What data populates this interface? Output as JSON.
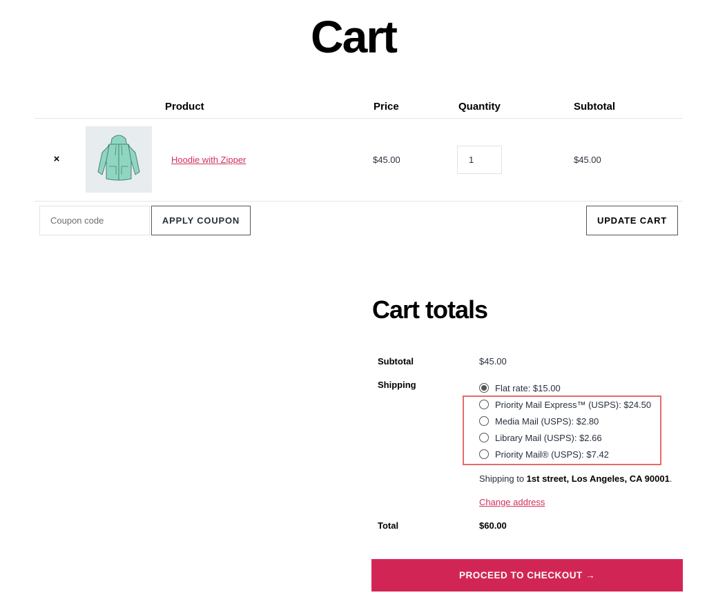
{
  "page": {
    "title": "Cart"
  },
  "table": {
    "headers": {
      "product": "Product",
      "price": "Price",
      "quantity": "Quantity",
      "subtotal": "Subtotal"
    },
    "rows": [
      {
        "remove_label": "×",
        "product_name": "Hoodie with Zipper",
        "thumbnail_icon": "hoodie-icon",
        "price": "$45.00",
        "quantity": "1",
        "subtotal": "$45.00"
      }
    ]
  },
  "coupon": {
    "placeholder": "Coupon code",
    "apply_label": "APPLY COUPON"
  },
  "update_label": "UPDATE CART",
  "totals": {
    "title": "Cart totals",
    "subtotal_label": "Subtotal",
    "subtotal_value": "$45.00",
    "shipping_label": "Shipping",
    "shipping_options": [
      {
        "label": "Flat rate: $15.00",
        "checked": true
      },
      {
        "label": "Priority Mail Express™ (USPS): $24.50",
        "checked": false
      },
      {
        "label": "Media Mail (USPS): $2.80",
        "checked": false
      },
      {
        "label": "Library Mail (USPS): $2.66",
        "checked": false
      },
      {
        "label": "Priority Mail® (USPS): $7.42",
        "checked": false
      }
    ],
    "shipping_to_prefix": "Shipping to ",
    "shipping_to_address": "1st street, Los Angeles, CA 90001",
    "shipping_to_suffix": ".",
    "change_address_label": "Change address",
    "total_label": "Total",
    "total_value": "$60.00"
  },
  "checkout_label": "PROCEED TO CHECKOUT →",
  "colors": {
    "accent": "#d12655",
    "link": "#d1305d",
    "highlight": "#e56a6a",
    "thumb_bg": "#e7ecef",
    "hoodie": "#8fd6c0"
  }
}
